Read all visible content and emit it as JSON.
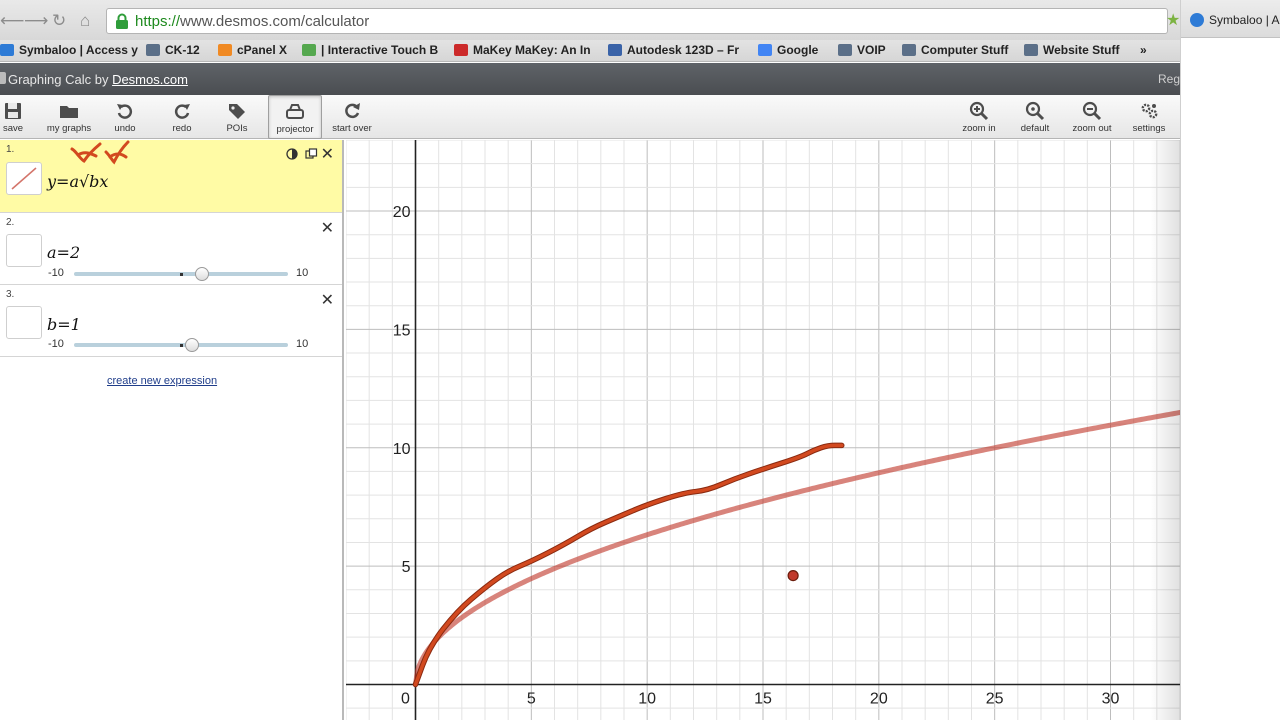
{
  "browser": {
    "url_scheme": "https://",
    "url_rest": "www.desmos.com/calculator",
    "bookmarks": [
      {
        "label": "Symbaloo | Access y",
        "icon": "symbaloo-icon",
        "color": "#2e7bd6"
      },
      {
        "label": "CK-12",
        "icon": "folder-icon",
        "color": "#5b6f88"
      },
      {
        "label": "cPanel X",
        "icon": "cpanel-icon",
        "color": "#f08a24"
      },
      {
        "label": "| Interactive Touch B",
        "icon": "globe-icon",
        "color": "#55a84f"
      },
      {
        "label": "MaKey MaKey: An In",
        "icon": "makey-icon",
        "color": "#cc2a2a"
      },
      {
        "label": "Autodesk 123D – Fr",
        "icon": "autodesk-icon",
        "color": "#3a63a8"
      },
      {
        "label": "Google",
        "icon": "google-icon",
        "color": "#4285f4"
      },
      {
        "label": "VOIP",
        "icon": "folder-icon",
        "color": "#5b6f88"
      },
      {
        "label": "Computer Stuff",
        "icon": "folder-icon",
        "color": "#5b6f88"
      },
      {
        "label": "Website Stuff",
        "icon": "folder-icon",
        "color": "#5b6f88"
      }
    ],
    "overflow_label": "»",
    "right_tab_label": "Symbaloo | A"
  },
  "app": {
    "title_prefix": "Graphing Calc by ",
    "title_link": "Desmos.com",
    "register_label": "Reg"
  },
  "toolbar": {
    "left": [
      {
        "id": "save",
        "label": "save",
        "icon": "save-icon"
      },
      {
        "id": "my-graphs",
        "label": "my graphs",
        "icon": "folder-icon"
      },
      {
        "id": "undo",
        "label": "undo",
        "icon": "undo-icon"
      },
      {
        "id": "redo",
        "label": "redo",
        "icon": "redo-icon"
      },
      {
        "id": "pois",
        "label": "POIs",
        "icon": "tag-icon"
      },
      {
        "id": "projector",
        "label": "projector",
        "icon": "projector-icon"
      },
      {
        "id": "start-over",
        "label": "start over",
        "icon": "refresh-icon"
      }
    ],
    "right": [
      {
        "id": "zoom-in",
        "label": "zoom in",
        "icon": "zoom-in-icon"
      },
      {
        "id": "default",
        "label": "default",
        "icon": "zoom-default-icon"
      },
      {
        "id": "zoom-out",
        "label": "zoom out",
        "icon": "zoom-out-icon"
      },
      {
        "id": "settings",
        "label": "settings",
        "icon": "gear-icon"
      }
    ]
  },
  "expressions": [
    {
      "num": "1.",
      "formula": "y=a√bx",
      "color": "#c0392b"
    },
    {
      "num": "2.",
      "formula": "a=2",
      "slider": {
        "min": "-10",
        "max": "10",
        "value": 2
      }
    },
    {
      "num": "3.",
      "formula": "b=1",
      "slider": {
        "min": "-10",
        "max": "10",
        "value": 1
      }
    }
  ],
  "create_expression_label": "create new expression",
  "chart_data": {
    "type": "line",
    "x_ticks": [
      "0",
      "5",
      "10",
      "15",
      "20",
      "25",
      "30"
    ],
    "y_ticks": [
      "5",
      "10",
      "15",
      "20"
    ],
    "xlim": [
      -3,
      33
    ],
    "ylim": [
      -1.5,
      23
    ],
    "grid": true,
    "series": [
      {
        "function": "y=2*sqrt(x)",
        "color": "#c0392b"
      }
    ],
    "annotation_stroke": {
      "color": "#d2491f",
      "points": [
        [
          0,
          0
        ],
        [
          0.6,
          1.6
        ],
        [
          1.8,
          3.1
        ],
        [
          3,
          4.1
        ],
        [
          4,
          4.8
        ],
        [
          5,
          5.2
        ],
        [
          6.4,
          5.9
        ],
        [
          7.6,
          6.6
        ],
        [
          8.8,
          7.1
        ],
        [
          10,
          7.6
        ],
        [
          11.6,
          8.1
        ],
        [
          12.6,
          8.2
        ],
        [
          13.8,
          8.7
        ],
        [
          15,
          9.1
        ],
        [
          16.6,
          9.6
        ],
        [
          17.2,
          9.9
        ],
        [
          17.8,
          10.1
        ],
        [
          18.4,
          10.1
        ]
      ]
    },
    "annotation_point": {
      "x": 16.3,
      "y": 4.6,
      "color": "#c0392b"
    },
    "annotation_checks": {
      "color": "#d2491f"
    }
  }
}
